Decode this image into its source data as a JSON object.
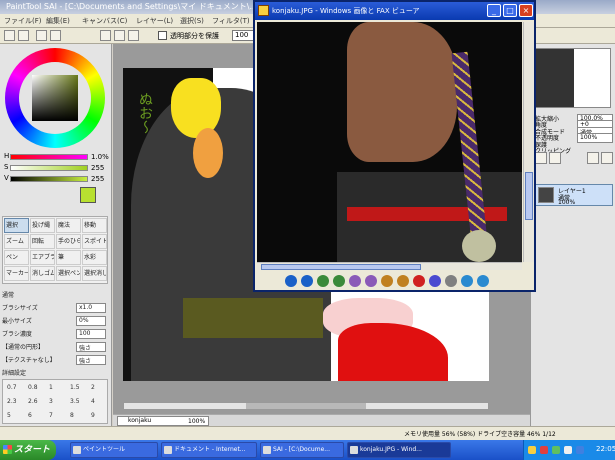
{
  "sai": {
    "title": "PaintTool SAI - [C:\\Documents and Settings\\マイ ドキュメント\\...]",
    "menu": [
      "ファイル(F)",
      "編集(E)",
      "キャンバス(C)",
      "レイヤー(L)",
      "選択(S)",
      "フィルタ(T)",
      "表示(V)",
      "ウィンドウ(W)"
    ],
    "toolbar": {
      "checkbox_label": "透明部分を保護",
      "zoom_value": "100"
    }
  },
  "left_panel": {
    "sliders": [
      {
        "label": "H",
        "value": "1.0%",
        "color_from": "#ff0000",
        "color_to": "#ff00ff"
      },
      {
        "label": "S",
        "value": "255",
        "color_from": "#ffffff",
        "color_to": "#a0d020"
      },
      {
        "label": "V",
        "value": "255",
        "color_from": "#000000",
        "color_to": "#c8f040"
      }
    ],
    "current_color": "#b8e030",
    "tools": [
      {
        "label": "選択",
        "active": true
      },
      {
        "label": "投げ縄",
        "active": false
      },
      {
        "label": "魔法",
        "active": false
      },
      {
        "label": "移動",
        "active": false
      },
      {
        "label": "ズーム",
        "active": false
      },
      {
        "label": "回転",
        "active": false
      },
      {
        "label": "手のひら",
        "active": false
      },
      {
        "label": "スポイト",
        "active": false
      },
      {
        "label": "ペン",
        "active": false
      },
      {
        "label": "エアブラシ",
        "active": false
      },
      {
        "label": "筆",
        "active": false
      },
      {
        "label": "水彩",
        "active": false
      },
      {
        "label": "マーカー",
        "active": false
      },
      {
        "label": "消しゴム",
        "active": false
      },
      {
        "label": "選択ペン",
        "active": false
      },
      {
        "label": "選択消し",
        "active": false
      }
    ],
    "properties": [
      {
        "label": "通常",
        "value": ""
      },
      {
        "label": "ブラシサイズ",
        "value": "x1.0"
      },
      {
        "label": "最小サイズ",
        "value": "0%"
      },
      {
        "label": "ブラシ濃度",
        "value": "100"
      },
      {
        "label": "【通常の円形】",
        "value": "強さ"
      },
      {
        "label": "【テクスチャなし】",
        "value": "強さ"
      }
    ],
    "detail_label": "詳細設定",
    "brush_sizes": [
      "0.7",
      "0.8",
      "1",
      "1.5",
      "2",
      "2.3",
      "2.6",
      "3",
      "3.5",
      "4",
      "5",
      "6",
      "7",
      "8",
      "9"
    ]
  },
  "canvas": {
    "art_text": "ぬお～",
    "tab_label": "konjaku",
    "tab_zoom": "100%"
  },
  "right_panel": {
    "rows": [
      {
        "label": "拡大縮小",
        "value": "100.0%"
      },
      {
        "label": "角度",
        "value": "+0"
      },
      {
        "label": "合成モード",
        "value": "通常"
      },
      {
        "label": "不透明度",
        "value": "100%"
      },
      {
        "label": "保護",
        "value": ""
      },
      {
        "label": "クリッピング",
        "value": ""
      }
    ],
    "layer": {
      "name": "レイヤー1",
      "mode": "通常",
      "opacity": "100%"
    }
  },
  "status": {
    "text": "メモリ使用量 56% (58%)  ドライブ空き容量 46%  1/12"
  },
  "viewer": {
    "title": "konjaku.JPG - Windows 画像と FAX ビューア",
    "min": "_",
    "max": "□",
    "close": "×",
    "toolbar_colors": [
      "#1a60c8",
      "#1a60c8",
      "#3a8a3a",
      "#3a8a3a",
      "#8a5ab8",
      "#8a5ab8",
      "#c08020",
      "#c08020",
      "#d02020",
      "#4a4ad0",
      "#808080",
      "#2a8ad0",
      "#2a8ad0"
    ]
  },
  "taskbar": {
    "start_label": "スタート",
    "tasks": [
      {
        "label": "ペイントツール",
        "active": false
      },
      {
        "label": "ドキュメント - Internet...",
        "active": false
      },
      {
        "label": "SAI - [C:\\Docume...",
        "active": false
      },
      {
        "label": "konjaku.JPG - Wind...",
        "active": true
      }
    ],
    "clock": "22:05"
  }
}
